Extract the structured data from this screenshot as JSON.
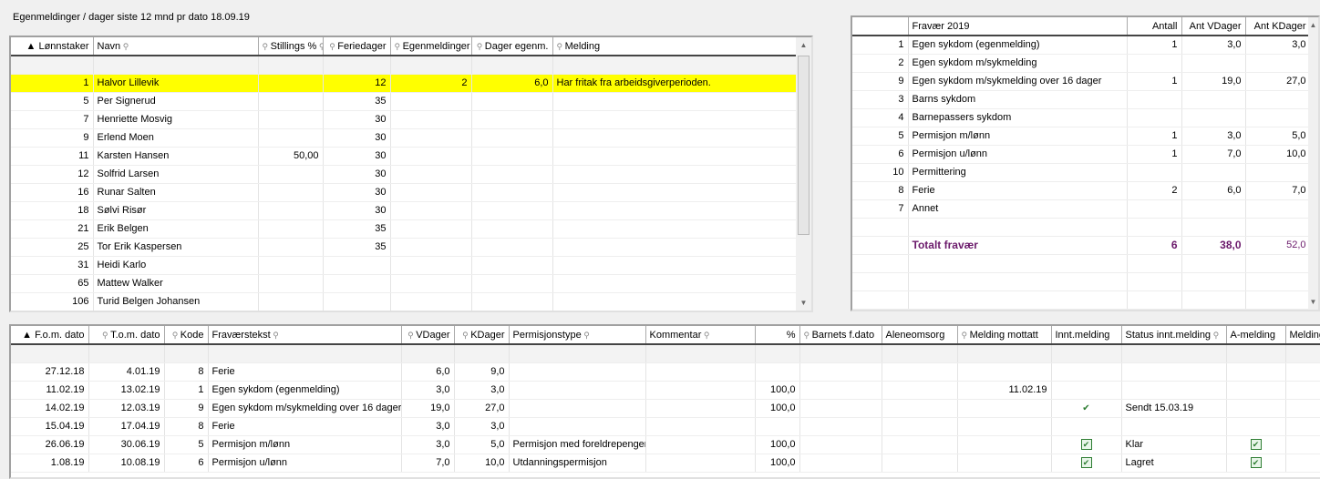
{
  "title": "Egenmeldinger / dager siste 12 mnd pr dato  18.09.19",
  "employees": {
    "columns": [
      {
        "label": "▲ Lønnstaker",
        "align": "r"
      },
      {
        "label": "Navn",
        "search": true
      },
      {
        "label": "Stillings %",
        "search": true,
        "pre": true,
        "align": "r"
      },
      {
        "label": "Feriedager",
        "pre": true,
        "align": "r"
      },
      {
        "label": "Egenmeldinger",
        "pre": true,
        "align": "r"
      },
      {
        "label": "Dager egenm.",
        "pre": true,
        "align": "r"
      },
      {
        "label": "Melding",
        "pre": true
      }
    ],
    "aligns": [
      "r",
      "",
      "r",
      "r",
      "r",
      "r",
      ""
    ],
    "rows": [
      [
        "1",
        "Halvor Lillevik",
        "",
        "12",
        "2",
        "6,0",
        "Har fritak fra arbeidsgiverperioden."
      ],
      [
        "5",
        "Per Signerud",
        "",
        "35",
        "",
        "",
        ""
      ],
      [
        "7",
        "Henriette Mosvig",
        "",
        "30",
        "",
        "",
        ""
      ],
      [
        "9",
        "Erlend Moen",
        "",
        "30",
        "",
        "",
        ""
      ],
      [
        "11",
        "Karsten Hansen",
        "50,00",
        "30",
        "",
        "",
        ""
      ],
      [
        "12",
        "Solfrid Larsen",
        "",
        "30",
        "",
        "",
        ""
      ],
      [
        "16",
        "Runar Salten",
        "",
        "30",
        "",
        "",
        ""
      ],
      [
        "18",
        "Sølvi Risør",
        "",
        "30",
        "",
        "",
        ""
      ],
      [
        "21",
        "Erik Belgen",
        "",
        "35",
        "",
        "",
        ""
      ],
      [
        "25",
        "Tor Erik Kaspersen",
        "",
        "35",
        "",
        "",
        ""
      ],
      [
        "31",
        "Heidi Karlo",
        "",
        "",
        "",
        "",
        ""
      ],
      [
        "65",
        "Mattew Walker",
        "",
        "",
        "",
        "",
        ""
      ],
      [
        "106",
        "Turid Belgen Johansen",
        "",
        "",
        "",
        "",
        ""
      ]
    ],
    "selected_row": 0,
    "highlight_color": "#ffff00"
  },
  "summary": {
    "columns": [
      {
        "label": ""
      },
      {
        "label": "Fravær 2019"
      },
      {
        "label": "Antall",
        "align": "r"
      },
      {
        "label": "Ant VDager",
        "align": "r"
      },
      {
        "label": "Ant KDager",
        "align": "r"
      }
    ],
    "aligns": [
      "r",
      "",
      "r",
      "r",
      "r"
    ],
    "rows": [
      [
        "1",
        "Egen sykdom (egenmelding)",
        "1",
        "3,0",
        "3,0"
      ],
      [
        "2",
        "Egen sykdom m/sykmelding",
        "",
        "",
        ""
      ],
      [
        "9",
        "Egen sykdom m/sykmelding over 16 dager",
        "1",
        "19,0",
        "27,0"
      ],
      [
        "3",
        "Barns sykdom",
        "",
        "",
        ""
      ],
      [
        "4",
        "Barnepassers sykdom",
        "",
        "",
        ""
      ],
      [
        "5",
        "Permisjon m/lønn",
        "1",
        "3,0",
        "5,0"
      ],
      [
        "6",
        "Permisjon u/lønn",
        "1",
        "7,0",
        "10,0"
      ],
      [
        "10",
        "Permittering",
        "",
        "",
        ""
      ],
      [
        "8",
        "Ferie",
        "2",
        "6,0",
        "7,0"
      ],
      [
        "7",
        "Annet",
        "",
        "",
        ""
      ]
    ],
    "total": {
      "label": "Totalt fravær",
      "antall": "6",
      "vdager": "38,0",
      "kdager": "52,0"
    },
    "total_color": "#6b1a6b"
  },
  "absences": {
    "columns": [
      {
        "label": "▲ F.o.m. dato",
        "align": "r"
      },
      {
        "label": "T.o.m. dato",
        "pre": true,
        "align": "r"
      },
      {
        "label": "Kode",
        "pre": true,
        "align": "r"
      },
      {
        "label": "Fraværstekst",
        "search": true
      },
      {
        "label": "VDager",
        "pre": true,
        "align": "r"
      },
      {
        "label": "KDager",
        "pre": true,
        "align": "r"
      },
      {
        "label": "Permisjonstype",
        "search": true
      },
      {
        "label": "Kommentar",
        "search": true
      },
      {
        "label": "%",
        "align": "r"
      },
      {
        "label": "Barnets f.dato",
        "pre": true
      },
      {
        "label": "Aleneomsorg"
      },
      {
        "label": "Melding mottatt",
        "pre": true
      },
      {
        "label": "Innt.melding"
      },
      {
        "label": "Status innt.melding",
        "search": true
      },
      {
        "label": "A-melding"
      },
      {
        "label": "Melding"
      }
    ],
    "aligns": [
      "r",
      "r",
      "r",
      "",
      "r",
      "r",
      "",
      "",
      "r",
      "",
      "",
      "r",
      "c",
      "",
      "c",
      ""
    ],
    "rows": [
      [
        "27.12.18",
        "4.01.19",
        "8",
        "Ferie",
        "6,0",
        "9,0",
        "",
        "",
        "",
        "",
        "",
        "",
        "",
        "",
        "",
        ""
      ],
      [
        "11.02.19",
        "13.02.19",
        "1",
        "Egen sykdom (egenmelding)",
        "3,0",
        "3,0",
        "",
        "",
        "100,0",
        "",
        "",
        "11.02.19",
        "",
        "",
        "",
        ""
      ],
      [
        "14.02.19",
        "12.03.19",
        "9",
        "Egen sykdom m/sykmelding over 16 dager",
        "19,0",
        "27,0",
        "",
        "",
        "100,0",
        "",
        "",
        "",
        "tick",
        "Sendt 15.03.19",
        "",
        ""
      ],
      [
        "15.04.19",
        "17.04.19",
        "8",
        "Ferie",
        "3,0",
        "3,0",
        "",
        "",
        "",
        "",
        "",
        "",
        "",
        "",
        "",
        ""
      ],
      [
        "26.06.19",
        "30.06.19",
        "5",
        "Permisjon m/lønn",
        "3,0",
        "5,0",
        "Permisjon med foreldrepenger",
        "",
        "100,0",
        "",
        "",
        "",
        "checked",
        "Klar",
        "checked",
        ""
      ],
      [
        "1.08.19",
        "10.08.19",
        "6",
        "Permisjon u/lønn",
        "7,0",
        "10,0",
        "Utdanningspermisjon",
        "",
        "100,0",
        "",
        "",
        "",
        "checked",
        "Lagret",
        "checked",
        ""
      ]
    ]
  }
}
